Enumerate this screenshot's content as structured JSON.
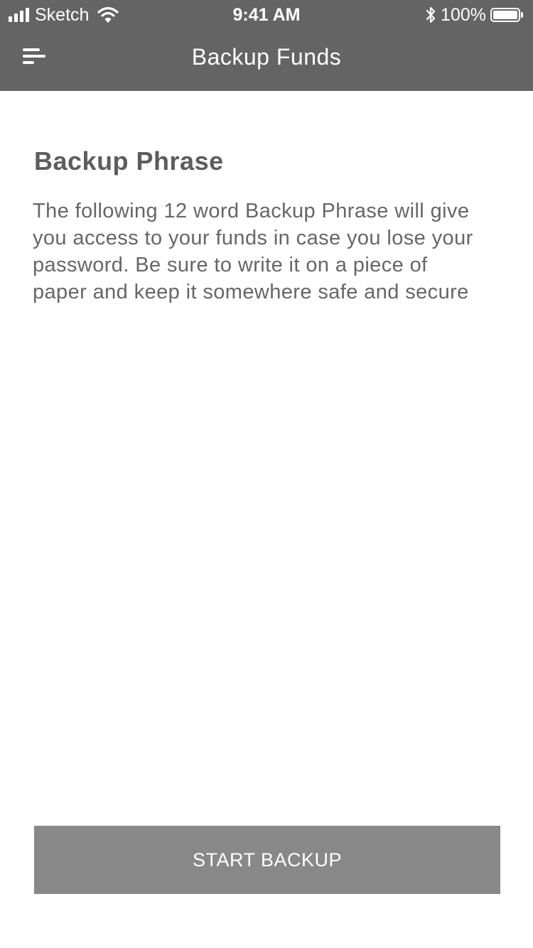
{
  "status_bar": {
    "carrier": "Sketch",
    "time": "9:41 AM",
    "battery_percent": "100%",
    "battery_level": 1.0,
    "icons": [
      "signal-icon",
      "wifi-icon",
      "bluetooth-icon",
      "battery-icon"
    ]
  },
  "navbar": {
    "menu_icon": "hamburger-menu-icon",
    "title": "Backup Funds"
  },
  "main": {
    "section_title": "Backup Phrase",
    "description": "The following 12 word Backup Phrase will give you access to your funds in case you lose your password. Be sure to write it on a piece of paper and keep it somewhere safe and secure"
  },
  "actions": {
    "start_backup_label": "START BACKUP"
  },
  "colors": {
    "header_background": "#646464",
    "button_background": "#888888",
    "title_text": "#5d5d5d",
    "body_text": "#666666",
    "page_background": "#ffffff"
  }
}
